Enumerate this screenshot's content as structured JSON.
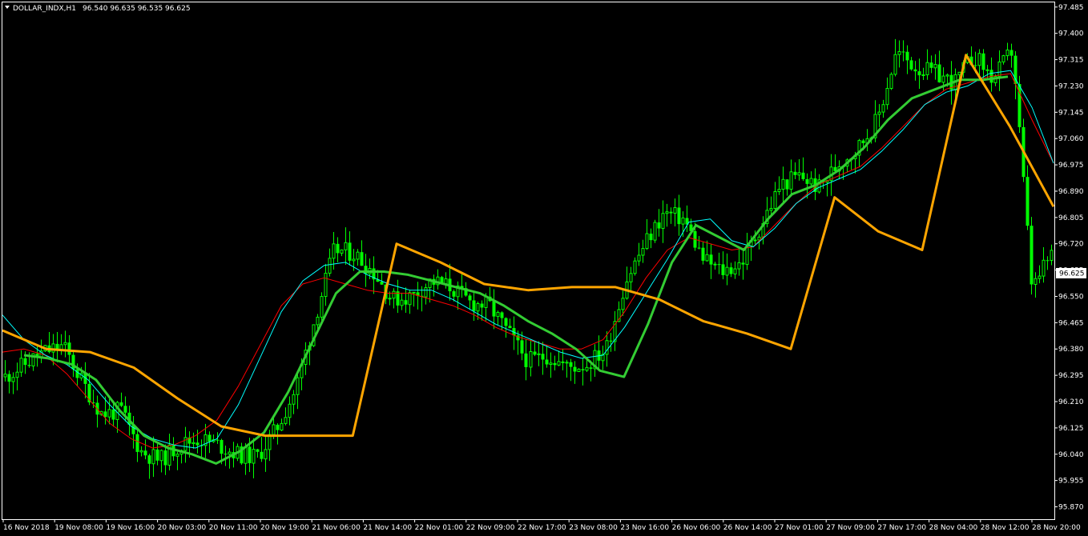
{
  "window": {
    "symbol_header": "DOLLAR_INDX,H1",
    "ohlc": "96.540 96.635 96.535 96.625",
    "menu_icon": "triangle-down-icon"
  },
  "colors": {
    "background": "#000000",
    "axis": "#ffffff",
    "candle": "#00ff00",
    "ma_fast": "#ff0000",
    "ma_slow": "#00ffff",
    "signal_up": "#33cc33",
    "signal_down": "#ffa500",
    "price_tag_bg": "#ffffff",
    "price_tag_text": "#000000"
  },
  "chart_data": {
    "type": "candlestick",
    "timeframe": "H1",
    "current_price": "96.625",
    "ylim": [
      95.83,
      97.5
    ],
    "y_ticks": [
      "97.485",
      "97.400",
      "97.315",
      "97.230",
      "97.145",
      "97.060",
      "96.975",
      "96.890",
      "96.805",
      "96.720",
      "96.635",
      "96.550",
      "96.465",
      "96.380",
      "96.295",
      "96.210",
      "96.125",
      "96.040",
      "95.955",
      "95.870"
    ],
    "x_ticks": [
      "16 Nov 2018",
      "19 Nov 08:00",
      "19 Nov 16:00",
      "20 Nov 03:00",
      "20 Nov 11:00",
      "20 Nov 19:00",
      "21 Nov 06:00",
      "21 Nov 14:00",
      "22 Nov 01:00",
      "22 Nov 09:00",
      "22 Nov 17:00",
      "23 Nov 08:00",
      "23 Nov 16:00",
      "26 Nov 06:00",
      "26 Nov 14:00",
      "27 Nov 01:00",
      "27 Nov 09:00",
      "27 Nov 17:00",
      "28 Nov 04:00",
      "28 Nov 12:00",
      "28 Nov 20:00"
    ],
    "close_anchors": [
      96.29,
      96.33,
      96.37,
      96.39,
      96.27,
      96.17,
      96.18,
      96.05,
      96.02,
      96.07,
      96.09,
      96.07,
      96.04,
      96.03,
      96.12,
      96.25,
      96.48,
      96.7,
      96.69,
      96.63,
      96.54,
      96.55,
      96.6,
      96.58,
      96.53,
      96.52,
      96.43,
      96.34,
      96.36,
      96.32,
      96.33,
      96.38,
      96.6,
      96.72,
      96.82,
      96.8,
      96.67,
      96.63,
      96.66,
      96.78,
      96.91,
      96.94,
      96.9,
      96.98,
      97.03,
      97.12,
      97.34,
      97.29,
      97.27,
      97.24,
      97.33,
      97.25,
      97.35,
      96.57,
      96.69
    ],
    "series": [
      {
        "name": "",
        "role": "ma_fast",
        "values": [
          96.37,
          96.38,
          96.36,
          96.3,
          96.22,
          96.14,
          96.09,
          96.06,
          96.07,
          96.1,
          96.15,
          96.26,
          96.39,
          96.52,
          96.59,
          96.61,
          96.59,
          96.57,
          96.56,
          96.56,
          96.54,
          96.52,
          96.49,
          96.45,
          96.42,
          96.4,
          96.38,
          96.38,
          96.41,
          96.5,
          96.61,
          96.7,
          96.74,
          96.72,
          96.7,
          96.71,
          96.78,
          96.85,
          96.91,
          96.94,
          96.97,
          97.03,
          97.1,
          97.17,
          97.22,
          97.24,
          97.26,
          97.27,
          97.12,
          96.98
        ]
      },
      {
        "name": "",
        "role": "ma_slow",
        "values": [
          96.49,
          96.41,
          96.36,
          96.33,
          96.28,
          96.2,
          96.13,
          96.09,
          96.07,
          96.06,
          96.09,
          96.2,
          96.35,
          96.5,
          96.6,
          96.65,
          96.66,
          96.62,
          96.59,
          96.57,
          96.57,
          96.54,
          96.5,
          96.46,
          96.43,
          96.4,
          96.37,
          96.35,
          96.36,
          96.45,
          96.56,
          96.67,
          96.79,
          96.8,
          96.73,
          96.71,
          96.77,
          96.85,
          96.9,
          96.93,
          96.96,
          97.02,
          97.09,
          97.17,
          97.21,
          97.23,
          97.27,
          97.28,
          97.16,
          96.98
        ]
      },
      {
        "name": "",
        "role": "signal_up_line",
        "values": [
          96.36,
          96.35,
          96.33,
          96.28,
          96.18,
          96.1,
          96.06,
          96.04,
          96.01,
          96.05,
          96.11,
          96.24,
          96.4,
          96.56,
          96.63,
          96.63,
          96.62,
          96.6,
          96.58,
          96.56,
          96.52,
          96.47,
          96.43,
          96.38,
          96.31,
          96.29,
          96.46,
          96.66,
          96.78,
          96.74,
          96.7,
          96.8,
          96.88,
          96.91,
          96.96,
          97.03,
          97.12,
          97.19,
          97.22,
          97.25,
          97.25,
          97.26
        ]
      },
      {
        "name": "",
        "role": "signal_down_line",
        "values": [
          96.44,
          96.38,
          96.37,
          96.32,
          96.22,
          96.13,
          96.1,
          96.1,
          96.1,
          96.72,
          96.66,
          96.59,
          96.57,
          96.58,
          96.58,
          96.54,
          96.47,
          96.43,
          96.38,
          96.87,
          96.76,
          96.7,
          97.33,
          97.1,
          96.84
        ]
      }
    ]
  }
}
